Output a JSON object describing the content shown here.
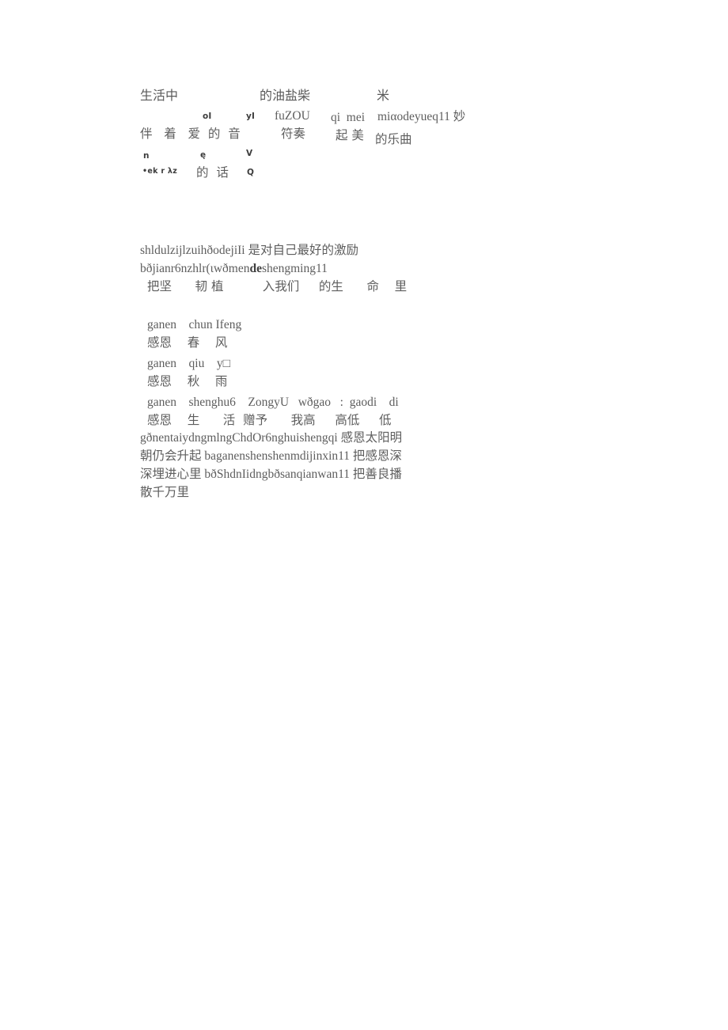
{
  "document": {
    "page_background": "#ffffff",
    "text_color": "#5e5e5e",
    "accent_color": "#3d3d3d"
  },
  "stanza_one": {
    "line1_cjk": "生活中",
    "line1_cjk_b": "的油盐柴",
    "line1_cjk_c": "米",
    "marks_row1": {
      "mark_a": "oI",
      "mark_b": "yI"
    },
    "line2_pinyin_a": "fuZOU",
    "line2_pinyin_b": "qi  mei",
    "line2_pinyin_c": "miαodeyueq11 妙",
    "line3_cjk": "伴   着   爱  的  音",
    "line3_cjk_b": "符奏",
    "line3_cjk_c": "起 美",
    "line3_cjk_d": "的乐曲",
    "marks_row2": {
      "mark_a": "n",
      "mark_b": "ę",
      "mark_c": "V"
    },
    "line4_ipa": "•ek r λz",
    "line4_cjk": "的  话",
    "line4_mark": "Q"
  },
  "stanza_two": {
    "line1": "shldulzijlzuihðodejiIi 是对自己最好的激励",
    "line2_pre": "bðjianr6nzhlr(ιwðmen",
    "line2_bold": "de",
    "line2_post": "shengming11",
    "line3": "把坚      韧 植          入我们     的生      命    里"
  },
  "stanza_three": {
    "couplets": [
      {
        "pinyin": "ganen    chun Ifeng",
        "cjk": "感恩    春    风"
      },
      {
        "pinyin": "ganen    qiu    y□",
        "cjk": "感恩    秋    雨"
      },
      {
        "pinyin": "ganen    shenghu6    ZongyU   wðgao   :  gaodi    di",
        "cjk": "感恩    生      活  赠予      我高     高低     低"
      }
    ],
    "flow_lines": [
      "gðnentaiydngmlngChdOr6nghuishengqi 感恩太阳明",
      "朝仍会升起 baganenshenshenmdijinxin11 把感恩深",
      "深埋进心里 bðShdnIidngbðsanqianwan11 把善良播",
      "散千万里"
    ]
  }
}
